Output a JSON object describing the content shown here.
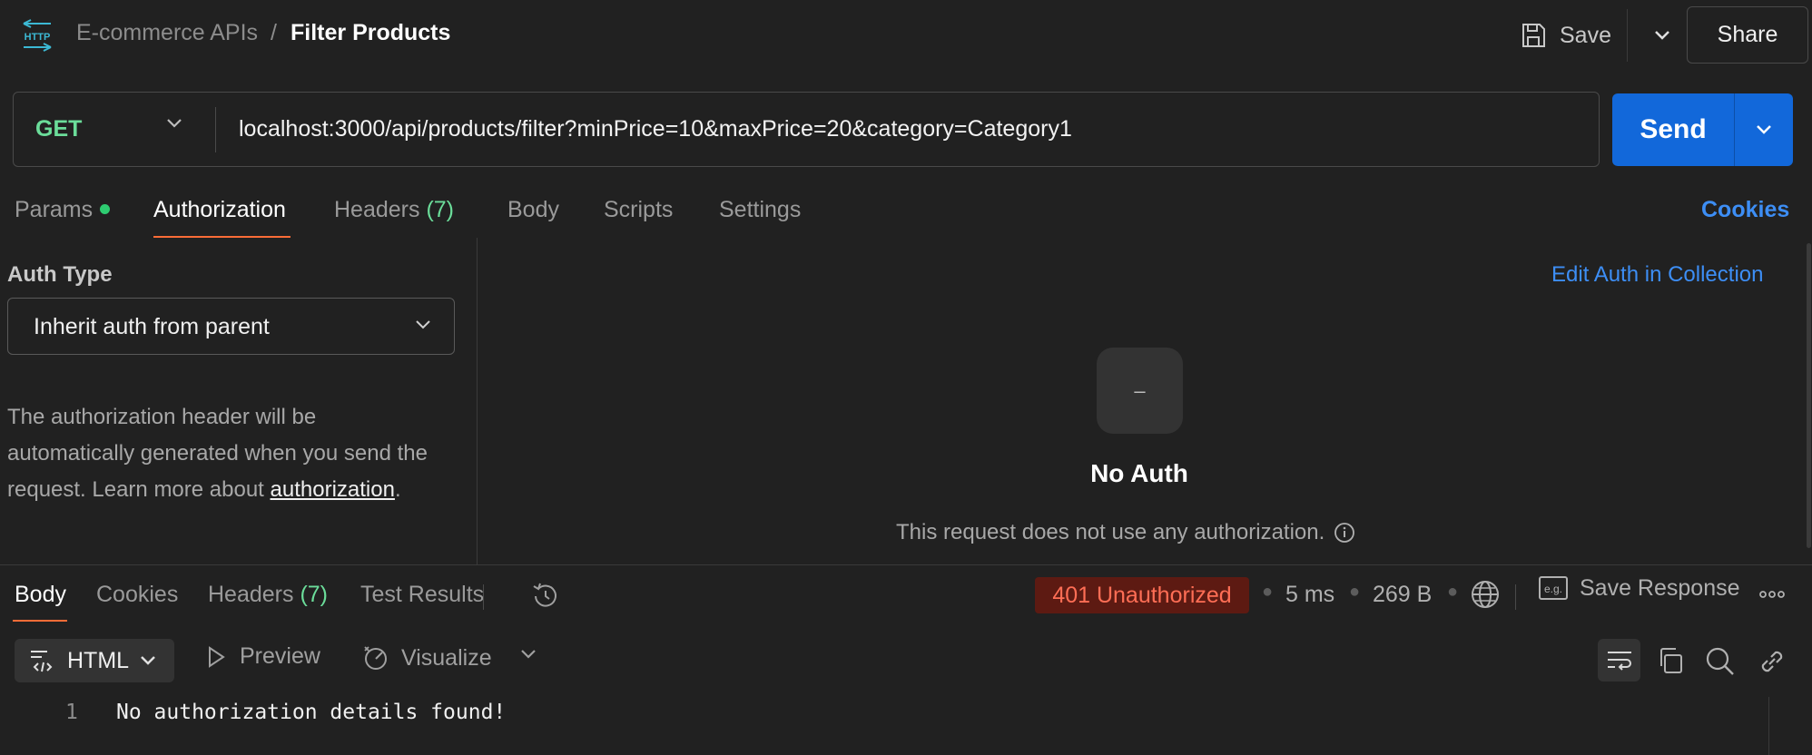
{
  "header": {
    "protocol_icon_label": "HTTP",
    "collection": "E-commerce APIs",
    "separator": "/",
    "request_name": "Filter Products",
    "save_label": "Save",
    "share_label": "Share"
  },
  "request": {
    "method": "GET",
    "url": "localhost:3000/api/products/filter?minPrice=10&maxPrice=20&category=Category1",
    "send_label": "Send"
  },
  "request_tabs": {
    "params": "Params",
    "authorization": "Authorization",
    "headers": "Headers",
    "headers_count": "(7)",
    "body": "Body",
    "scripts": "Scripts",
    "settings": "Settings",
    "cookies": "Cookies",
    "active": "Authorization"
  },
  "auth": {
    "type_label": "Auth Type",
    "selected_type": "Inherit auth from parent",
    "description": "The authorization header will be automatically generated when you send the request. Learn more about ",
    "link_text": "authorization",
    "period": ".",
    "edit_link": "Edit Auth in Collection",
    "panel_icon_glyph": "–",
    "panel_title": "No Auth",
    "panel_description": "This request does not use any authorization."
  },
  "response": {
    "tabs": {
      "body": "Body",
      "cookies": "Cookies",
      "headers": "Headers",
      "headers_count": "(7)",
      "test_results": "Test Results",
      "active": "Body"
    },
    "status": "401 Unauthorized",
    "status_color": "#ff6e55",
    "time": "5 ms",
    "size": "269 B",
    "save_response_label": "Save Response",
    "format": "HTML",
    "preview_label": "Preview",
    "visualize_label": "Visualize",
    "body_lines": [
      {
        "number": "1",
        "text": "No authorization details found!"
      }
    ]
  },
  "colors": {
    "accent_orange": "#ff6c37",
    "send_blue": "#1268da",
    "link_blue": "#3d8ef5",
    "method_green": "#6bdd9a"
  },
  "icons": {
    "protocol": "http-icon",
    "save": "floppy-disk-icon",
    "globe": "globe-icon",
    "example": "example-icon",
    "history": "history-icon",
    "wrap": "wrap-lines-icon",
    "copy": "copy-icon",
    "search": "search-icon",
    "link": "link-icon"
  }
}
